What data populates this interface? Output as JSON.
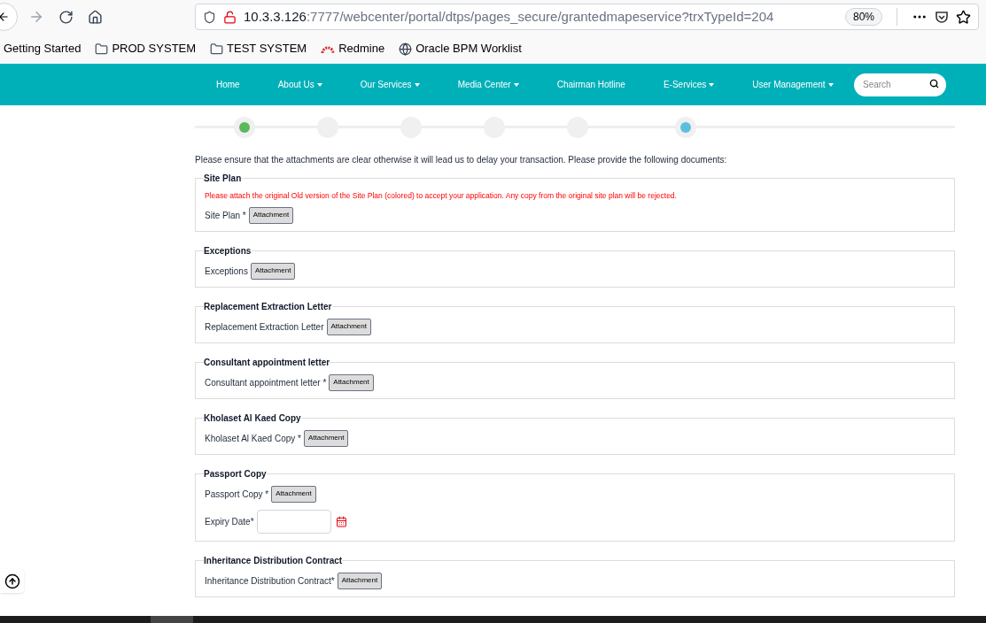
{
  "browser": {
    "url_host": "10.3.3.126",
    "url_rest": ":7777/webcenter/portal/dtps/pages_secure/grantedmapeservice?trxTypeId=204",
    "zoom": "80%"
  },
  "bookmarks": [
    {
      "label": "Getting Started",
      "kind": "page"
    },
    {
      "label": "PROD SYSTEM",
      "kind": "folder"
    },
    {
      "label": "TEST SYSTEM",
      "kind": "folder"
    },
    {
      "label": "Redmine",
      "kind": "redmine"
    },
    {
      "label": "Oracle BPM Worklist",
      "kind": "globe"
    }
  ],
  "nav": {
    "items": [
      {
        "label": "Home",
        "dropdown": false
      },
      {
        "label": "About Us",
        "dropdown": true
      },
      {
        "label": "Our Services",
        "dropdown": true
      },
      {
        "label": "Media Center",
        "dropdown": true
      },
      {
        "label": "Chairman Hotline",
        "dropdown": false
      },
      {
        "label": "E-Services",
        "dropdown": true
      },
      {
        "label": "User Management",
        "dropdown": true
      }
    ],
    "search": {
      "placeholder": "Search"
    }
  },
  "steps": [
    {
      "kind": "done"
    },
    {
      "kind": "pending"
    },
    {
      "kind": "pending"
    },
    {
      "kind": "pending"
    },
    {
      "kind": "pending"
    },
    {
      "kind": "current"
    }
  ],
  "intro": "Please ensure that the attachments are clear otherwise it will lead us to delay your transaction. Please provide the following documents:",
  "sections": [
    {
      "title": "Site Plan",
      "note": "Please attach the original Old version of the Site Plan (colored) to accept your application. Any copy from the original site plan will be rejected.",
      "fields": [
        {
          "kind": "attachment",
          "label": "Site Plan *",
          "button": "Attachment"
        }
      ]
    },
    {
      "title": "Exceptions",
      "fields": [
        {
          "kind": "attachment",
          "label": "Exceptions",
          "button": "Attachment"
        }
      ]
    },
    {
      "title": "Replacement Extraction Letter",
      "fields": [
        {
          "kind": "attachment",
          "label": "Replacement Extraction Letter",
          "button": "Attachment"
        }
      ]
    },
    {
      "title": "Consultant appointment letter",
      "fields": [
        {
          "kind": "attachment",
          "label": "Consultant appointment letter *",
          "button": "Attachment"
        }
      ]
    },
    {
      "title": "Kholaset Al Kaed Copy",
      "fields": [
        {
          "kind": "attachment",
          "label": "Kholaset Al Kaed Copy *",
          "button": "Attachment"
        }
      ]
    },
    {
      "title": "Passport Copy",
      "fields": [
        {
          "kind": "attachment",
          "label": "Passport Copy *",
          "button": "Attachment"
        },
        {
          "kind": "date",
          "label": "Expiry Date*"
        }
      ]
    },
    {
      "title": "Inheritance Distribution Contract",
      "fields": [
        {
          "kind": "attachment",
          "label": "Inheritance Distribution Contract*",
          "button": "Attachment"
        }
      ]
    }
  ]
}
